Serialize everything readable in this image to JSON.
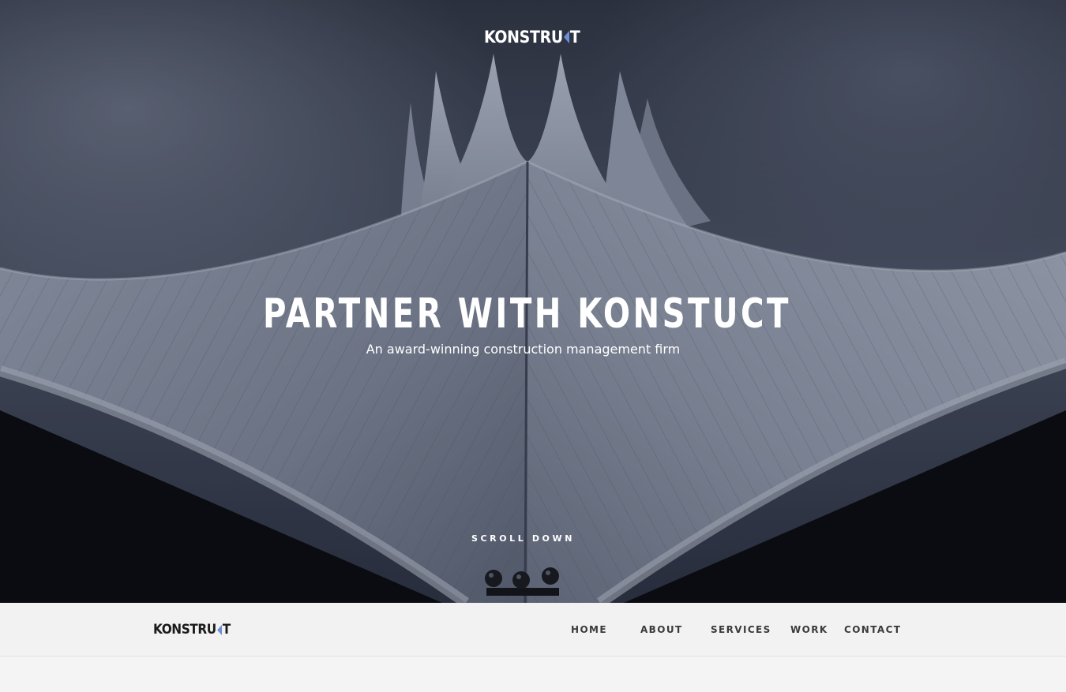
{
  "hero": {
    "logo": {
      "prefix": "KONSTRU",
      "suffix": "T",
      "accent_color": "#6f8fd6"
    },
    "title": "PARTNER WITH KONSTUCT",
    "subtitle": "An award-winning construction management firm",
    "scroll_label": "SCROLL DOWN",
    "background": "cloudy-sky-tent-roof-photo"
  },
  "navbar": {
    "logo": {
      "prefix": "KONSTRU",
      "suffix": "T",
      "accent_color": "#6f8fd6"
    },
    "items": [
      {
        "label": "HOME"
      },
      {
        "label": "ABOUT"
      },
      {
        "label": "SERVICES"
      },
      {
        "label": "WORK"
      },
      {
        "label": "CONTACT"
      }
    ]
  }
}
